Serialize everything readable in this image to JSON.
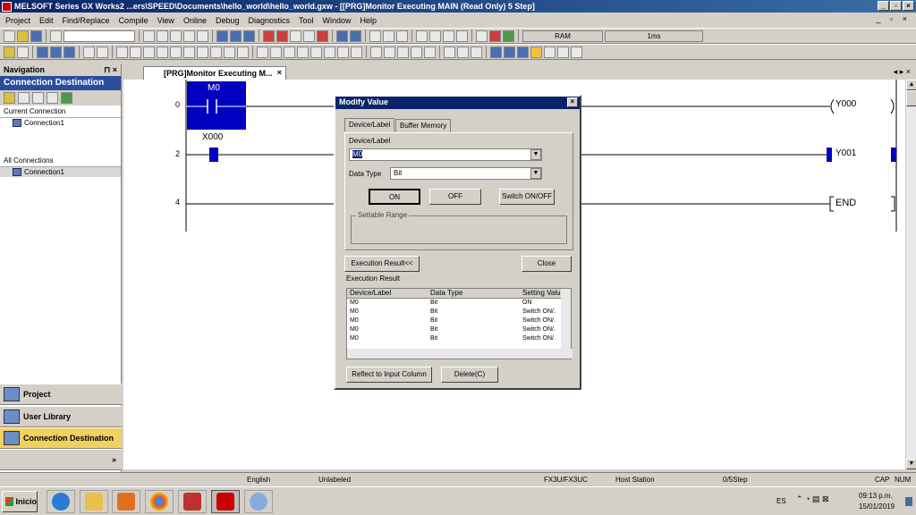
{
  "window": {
    "title": "MELSOFT Series GX Works2 ...ers\\SPEED\\Documents\\hello_world\\hello_world.gxw - [[PRG]Monitor Executing MAIN (Read Only) 5 Step]"
  },
  "menu": [
    "Project",
    "Edit",
    "Find/Replace",
    "Compile",
    "View",
    "Online",
    "Debug",
    "Diagnostics",
    "Tool",
    "Window",
    "Help"
  ],
  "toolbar": {
    "ram_label": "RAM",
    "scan_time": "1ms"
  },
  "navigation": {
    "header": "Navigation",
    "pin": "1 ×",
    "title": "Connection Destination",
    "current_section": "Current Connection",
    "current_item": "Connection1",
    "all_section": "All Connections",
    "all_item": "Connection1",
    "buttons": [
      "Project",
      "User Library",
      "Connection Destination"
    ]
  },
  "editor": {
    "tab_label": "[PRG]Monitor Executing M...",
    "rung_numbers": [
      "0",
      "2",
      "4"
    ],
    "contact1_label": "M0",
    "contact2_label": "X000",
    "coil1_label": "Y000",
    "coil2_label": "Y001",
    "end_label": "END"
  },
  "dialog": {
    "title": "Modify Value",
    "tabs": [
      "Device/Label",
      "Buffer Memory"
    ],
    "device_label_caption": "Device/Label",
    "device_value": "M0",
    "data_type_caption": "Data Type",
    "data_type_value": "Bit",
    "on_button": "ON",
    "off_button": "OFF",
    "switch_button": "Switch ON/OFF",
    "settable_range": "Settable Range",
    "exec_result_button": "Execution Result<<",
    "close_button": "Close",
    "exec_result_caption": "Execution Result",
    "columns": [
      "Device/Label",
      "Data Type",
      "Setting Valu"
    ],
    "rows": [
      [
        "M0",
        "Bit",
        "ON"
      ],
      [
        "M0",
        "Bit",
        "Switch ON/."
      ],
      [
        "M0",
        "Bit",
        "Switch ON/."
      ],
      [
        "M0",
        "Bit",
        "Switch ON/."
      ],
      [
        "M0",
        "Bit",
        "Switch ON/."
      ]
    ],
    "reflect_button": "Reflect to Input Column",
    "delete_button": "Delete(C)"
  },
  "statusbar": {
    "language": "English",
    "label": "Unlabeled",
    "plc": "FX3U/FX3UC",
    "station": "Host Station",
    "step": "0/5Step",
    "cap": "CAP",
    "num": "NUM"
  },
  "taskbar": {
    "start": "Inicio",
    "lang": "ES",
    "time": "09:13 p.m.",
    "date": "15/01/2019"
  },
  "colors": {
    "title_bg": "#0a246a",
    "nav_title_bg": "#2a4d9e",
    "contact_highlight": "#0000c0"
  }
}
